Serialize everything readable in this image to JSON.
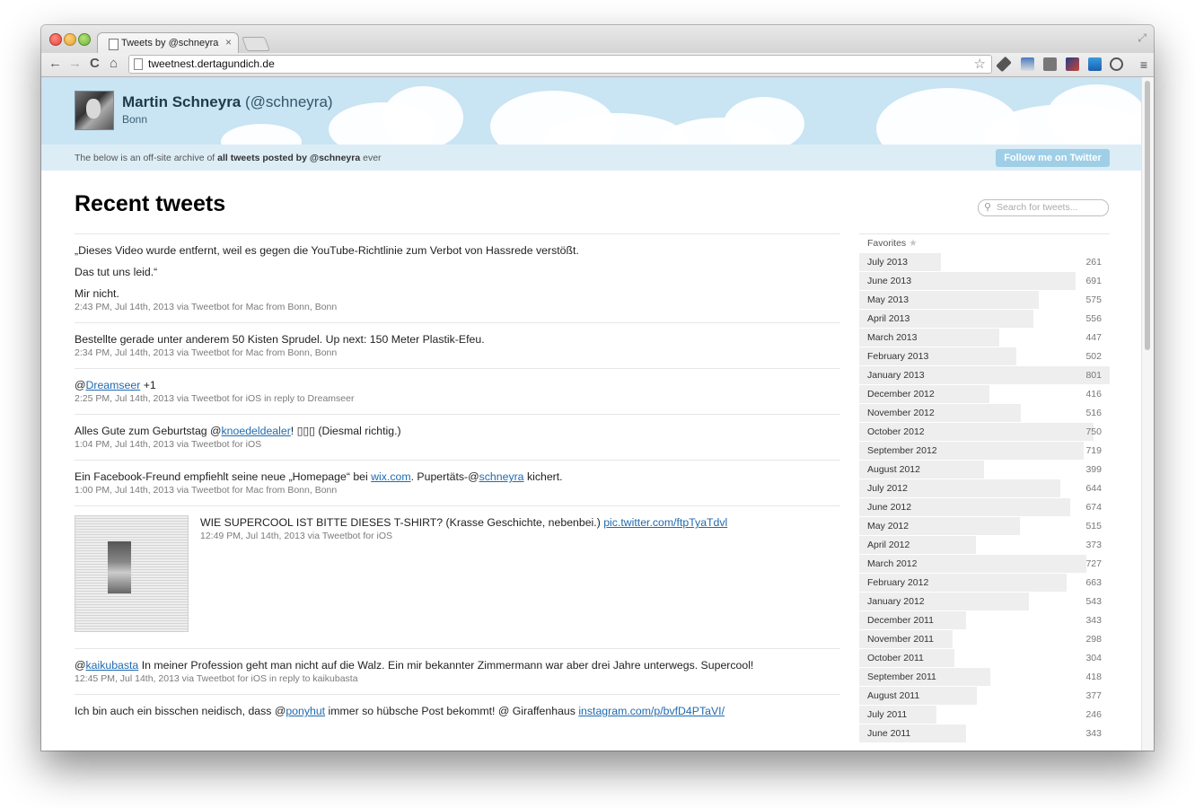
{
  "browser": {
    "tab_title": "Tweets by @schneyra",
    "tab_close": "×",
    "url": "tweetnest.dertagundich.de",
    "back": "←",
    "forward": "→",
    "reload": "C",
    "home": "⌂",
    "bookmark_star": "☆",
    "menu": "≡",
    "fullscreen": "⤢"
  },
  "profile": {
    "name": "Martin Schneyra",
    "handle": "(@schneyra)",
    "location": "Bonn"
  },
  "subbar": {
    "prefix": "The below is an off-site archive of ",
    "bold": "all tweets posted by @schneyra",
    "suffix": " ever",
    "follow_button": "Follow me on Twitter"
  },
  "main": {
    "heading": "Recent tweets",
    "search_placeholder": "Search for tweets...",
    "search_icon": "⚲"
  },
  "tweets": [
    {
      "lines": [
        "„Dieses Video wurde entfernt, weil es gegen die YouTube-Richtlinie zum Verbot von Hassrede verstößt.",
        "Das tut uns leid.“",
        "Mir nicht."
      ],
      "meta": "2:43 PM, Jul 14th, 2013 via Tweetbot for Mac from Bonn, Bonn"
    },
    {
      "text": "Bestellte gerade unter anderem 50 Kisten Sprudel. Up next: 150 Meter Plastik-Efeu.",
      "meta": "2:34 PM, Jul 14th, 2013 via Tweetbot for Mac from Bonn, Bonn"
    },
    {
      "pre": "@",
      "link": "Dreamseer",
      "post": " +1",
      "meta": "2:25 PM, Jul 14th, 2013 via Tweetbot for iOS in reply to Dreamseer"
    },
    {
      "pre": "Alles Gute zum Geburtstag @",
      "link": "knoedeldealer",
      "post": "! ▯▯▯ (Diesmal richtig.)",
      "meta": "1:04 PM, Jul 14th, 2013 via Tweetbot for iOS"
    },
    {
      "pre": "Ein Facebook-Freund empfiehlt seine neue „Homepage“ bei ",
      "link": "wix.com",
      "mid": ". Pupertäts-@",
      "link2": "schneyra",
      "post": " kichert.",
      "meta": "1:00 PM, Jul 14th, 2013 via Tweetbot for Mac from Bonn, Bonn"
    },
    {
      "pre": "WIE SUPERCOOL IST BITTE DIESES T-SHIRT? (Krasse Geschichte, nebenbei.) ",
      "link": "pic.twitter.com/ftpTyaTdvl",
      "meta": "12:49 PM, Jul 14th, 2013 via Tweetbot for iOS"
    },
    {
      "pre": "@",
      "link": "kaikubasta",
      "post": " In meiner Profession geht man nicht auf die Walz. Ein mir bekannter Zimmermann war aber drei Jahre unterwegs. Supercool!",
      "meta": "12:45 PM, Jul 14th, 2013 via Tweetbot for iOS in reply to kaikubasta"
    },
    {
      "pre": "Ich bin auch ein bisschen neidisch, dass @",
      "link": "ponyhut",
      "mid": " immer so hübsche Post bekommt! @ Giraffenhaus ",
      "link2": "instagram.com/p/bvfD4PTaVI/"
    }
  ],
  "sidebar": {
    "favorites_label": "Favorites",
    "favorites_star": "★",
    "max_count": 801,
    "months": [
      {
        "label": "July 2013",
        "count": 261
      },
      {
        "label": "June 2013",
        "count": 691
      },
      {
        "label": "May 2013",
        "count": 575
      },
      {
        "label": "April 2013",
        "count": 556
      },
      {
        "label": "March 2013",
        "count": 447
      },
      {
        "label": "February 2013",
        "count": 502
      },
      {
        "label": "January 2013",
        "count": 801
      },
      {
        "label": "December 2012",
        "count": 416
      },
      {
        "label": "November 2012",
        "count": 516
      },
      {
        "label": "October 2012",
        "count": 750
      },
      {
        "label": "September 2012",
        "count": 719
      },
      {
        "label": "August 2012",
        "count": 399
      },
      {
        "label": "July 2012",
        "count": 644
      },
      {
        "label": "June 2012",
        "count": 674
      },
      {
        "label": "May 2012",
        "count": 515
      },
      {
        "label": "April 2012",
        "count": 373
      },
      {
        "label": "March 2012",
        "count": 727
      },
      {
        "label": "February 2012",
        "count": 663
      },
      {
        "label": "January 2012",
        "count": 543
      },
      {
        "label": "December 2011",
        "count": 343
      },
      {
        "label": "November 2011",
        "count": 298
      },
      {
        "label": "October 2011",
        "count": 304
      },
      {
        "label": "September 2011",
        "count": 418
      },
      {
        "label": "August 2011",
        "count": 377
      },
      {
        "label": "July 2011",
        "count": 246
      },
      {
        "label": "June 2011",
        "count": 343
      }
    ]
  }
}
